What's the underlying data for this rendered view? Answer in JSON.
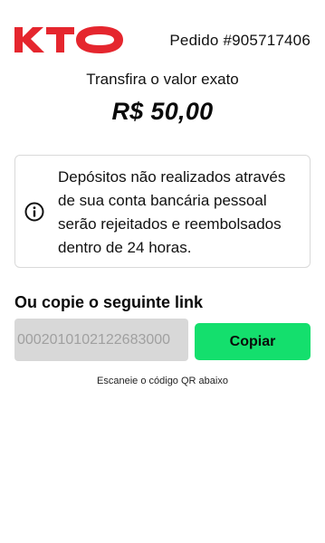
{
  "header": {
    "brand": "KTO",
    "brand_color": "#e5262e",
    "order_label": "Pedido #905717406"
  },
  "payment": {
    "instruction": "Transfira o valor exato",
    "amount": "R$ 50,00"
  },
  "notice": {
    "icon": "info-icon",
    "text": "Depósitos não realizados através de sua conta bancária pessoal serão rejeitados e reembolsados dentro de 24 horas."
  },
  "copy_section": {
    "heading": "Ou copie o seguinte link",
    "link_value": "0002010102122683000",
    "button_label": "Copiar",
    "button_color": "#14df6d"
  },
  "qr": {
    "caption": "Escaneie o código QR abaixo"
  }
}
